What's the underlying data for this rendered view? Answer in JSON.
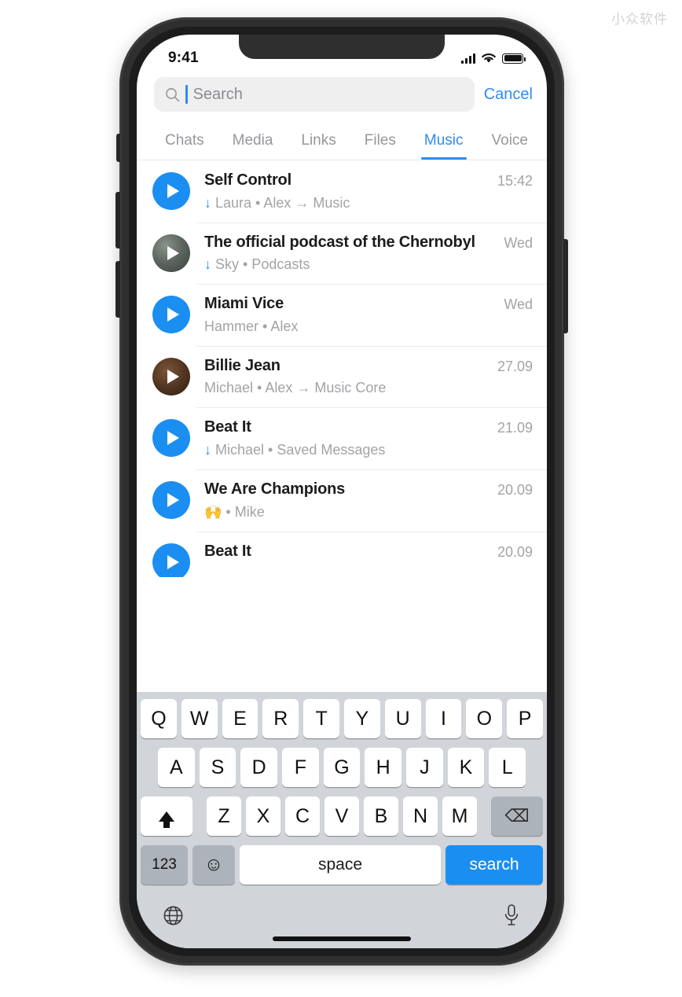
{
  "watermark": "小众软件",
  "status_bar": {
    "time": "9:41",
    "signal_icon": "cellular-bars-icon",
    "wifi_icon": "wifi-icon",
    "battery_icon": "battery-full-icon"
  },
  "search": {
    "placeholder": "Search",
    "value": "",
    "icon": "search-icon",
    "cancel_label": "Cancel"
  },
  "tabs": [
    {
      "label": "Chats",
      "active": false
    },
    {
      "label": "Media",
      "active": false
    },
    {
      "label": "Links",
      "active": false
    },
    {
      "label": "Files",
      "active": false
    },
    {
      "label": "Music",
      "active": true
    },
    {
      "label": "Voice",
      "active": false
    }
  ],
  "results": [
    {
      "title": "Self Control",
      "downloaded": true,
      "subtitle": "Laura • Alex → Music",
      "date": "15:42",
      "thumb": "play-icon-blue"
    },
    {
      "title": "The official podcast of the Chernobyl",
      "downloaded": true,
      "subtitle": "Sky • Podcasts",
      "date": "Wed",
      "thumb": "album-art-podcast"
    },
    {
      "title": "Miami Vice",
      "downloaded": false,
      "subtitle": "Hammer • Alex",
      "date": "Wed",
      "thumb": "play-icon-blue"
    },
    {
      "title": "Billie Jean",
      "downloaded": false,
      "subtitle": "Michael • Alex → Music Core",
      "date": "27.09",
      "thumb": "album-art-billie-jean"
    },
    {
      "title": "Beat It",
      "downloaded": true,
      "subtitle": "Michael • Saved Messages",
      "date": "21.09",
      "thumb": "play-icon-blue"
    },
    {
      "title": "We Are Champions",
      "downloaded": false,
      "subtitle": "🙌 • Mike",
      "date": "20.09",
      "thumb": "play-icon-blue"
    },
    {
      "title": "Beat It",
      "downloaded": false,
      "subtitle": "",
      "date": "20.09",
      "thumb": "play-icon-blue"
    }
  ],
  "keyboard": {
    "row1": [
      "Q",
      "W",
      "E",
      "R",
      "T",
      "Y",
      "U",
      "I",
      "O",
      "P"
    ],
    "row2": [
      "A",
      "S",
      "D",
      "F",
      "G",
      "H",
      "J",
      "K",
      "L"
    ],
    "row3": [
      "Z",
      "X",
      "C",
      "V",
      "B",
      "N",
      "M"
    ],
    "shift_label": "shift-key",
    "backspace_label": "⌫",
    "numbers_label": "123",
    "emoji_label": "☺",
    "space_label": "space",
    "return_label": "search",
    "globe_label": "🌐",
    "mic_label": "🎙"
  },
  "colors": {
    "accent": "#1b8ef2",
    "link": "#2f8cf0",
    "keyboard_bg": "#d1d5da",
    "secondary_text": "#a3a3a8"
  }
}
